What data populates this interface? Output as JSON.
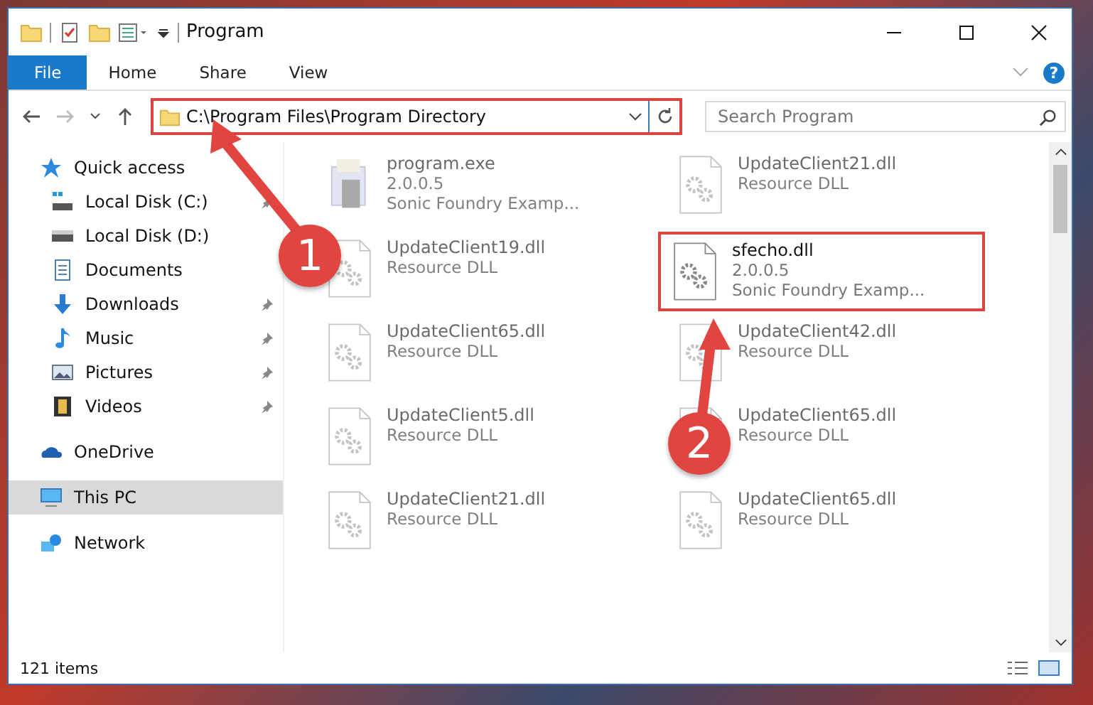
{
  "window": {
    "title": "Program"
  },
  "ribbon": {
    "tabs": [
      {
        "label": "File",
        "selected": true
      },
      {
        "label": "Home",
        "selected": false
      },
      {
        "label": "Share",
        "selected": false
      },
      {
        "label": "View",
        "selected": false
      }
    ],
    "help": "?"
  },
  "address": {
    "path": "C:\\Program Files\\Program Directory",
    "highlighted": true
  },
  "search": {
    "placeholder": "Search Program"
  },
  "sidebar": {
    "items": [
      {
        "label": "Quick access",
        "kind": "star",
        "selected": false,
        "children": [
          {
            "label": "Local Disk (C:)",
            "kind": "disk-c",
            "pinned": true
          },
          {
            "label": "Local Disk (D:)",
            "kind": "disk",
            "pinned": false
          },
          {
            "label": "Documents",
            "kind": "documents",
            "pinned": false
          },
          {
            "label": "Downloads",
            "kind": "downloads",
            "pinned": true
          },
          {
            "label": "Music",
            "kind": "music",
            "pinned": true
          },
          {
            "label": "Pictures",
            "kind": "pictures",
            "pinned": true
          },
          {
            "label": "Videos",
            "kind": "videos",
            "pinned": true
          }
        ]
      },
      {
        "label": "OneDrive",
        "kind": "cloud",
        "selected": false
      },
      {
        "label": "This PC",
        "kind": "pc",
        "selected": true
      },
      {
        "label": "Network",
        "kind": "network",
        "selected": false
      }
    ]
  },
  "files": [
    {
      "name": "program.exe",
      "lines": [
        "2.0.0.5",
        "Sonic Foundry Examp..."
      ],
      "kind": "exe",
      "blurred": true,
      "highlighted": false
    },
    {
      "name": "UpdateClient21.dll",
      "lines": [
        "Resource DLL"
      ],
      "kind": "dll",
      "blurred": true,
      "highlighted": false
    },
    {
      "name": "UpdateClient19.dll",
      "lines": [
        "Resource DLL"
      ],
      "kind": "dll",
      "blurred": true,
      "highlighted": false
    },
    {
      "name": "sfecho.dll",
      "lines": [
        "2.0.0.5",
        "Sonic Foundry Examp..."
      ],
      "kind": "dll",
      "blurred": false,
      "highlighted": true
    },
    {
      "name": "UpdateClient65.dll",
      "lines": [
        "Resource DLL"
      ],
      "kind": "dll",
      "blurred": true,
      "highlighted": false
    },
    {
      "name": "UpdateClient42.dll",
      "lines": [
        "Resource DLL"
      ],
      "kind": "dll",
      "blurred": true,
      "highlighted": false
    },
    {
      "name": "UpdateClient5.dll",
      "lines": [
        "Resource DLL"
      ],
      "kind": "dll",
      "blurred": true,
      "highlighted": false
    },
    {
      "name": "UpdateClient65.dll",
      "lines": [
        "Resource DLL"
      ],
      "kind": "dll",
      "blurred": true,
      "highlighted": false
    },
    {
      "name": "UpdateClient21.dll",
      "lines": [
        "Resource DLL"
      ],
      "kind": "dll",
      "blurred": true,
      "highlighted": false
    },
    {
      "name": "UpdateClient65.dll",
      "lines": [
        "Resource DLL"
      ],
      "kind": "dll",
      "blurred": true,
      "highlighted": false
    }
  ],
  "status_bar": {
    "count": "121 items"
  },
  "annotations": [
    {
      "number": "1"
    },
    {
      "number": "2"
    }
  ]
}
